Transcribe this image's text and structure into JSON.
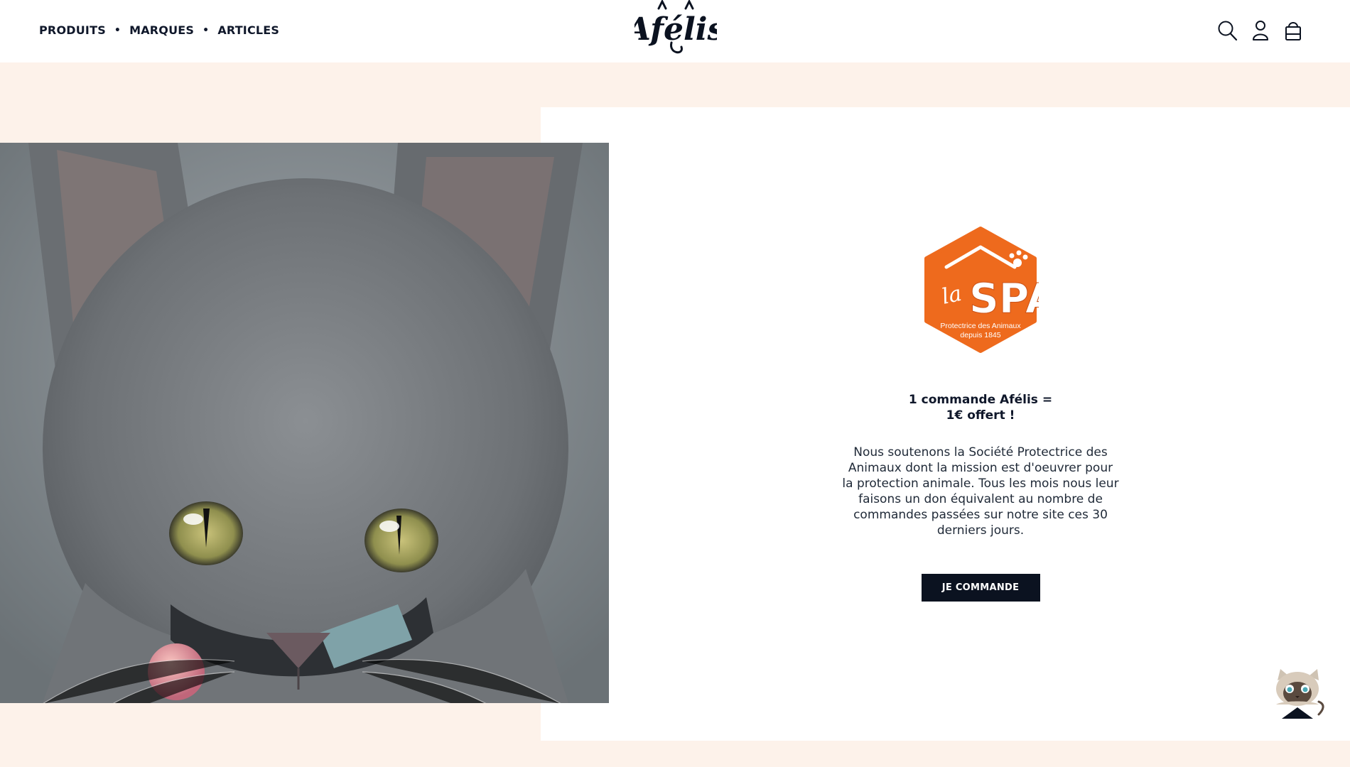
{
  "header": {
    "nav": [
      {
        "label": "PRODUITS"
      },
      {
        "label": "MARQUES"
      },
      {
        "label": "ARTICLES"
      }
    ],
    "nav_separator": "•",
    "logo_text": "Afélis",
    "icons": [
      "search-icon",
      "account-icon",
      "cart-icon"
    ]
  },
  "promo": {
    "partner_logo": {
      "brand": "la SPA",
      "tagline_line1": "Protectrice des Animaux",
      "tagline_line2": "depuis 1845",
      "color": "#ee6a1d"
    },
    "title_line1": "1 commande Afélis =",
    "title_line2": "1€ offert !",
    "body": "Nous soutenons la Société Protectrice des Animaux dont la mission est d'oeuvrer pour la protection animale. Tous les mois nous leur faisons un don équivalent au nombre de commandes passées sur notre site ces 30 derniers jours.",
    "cta_label": "JE COMMANDE"
  },
  "colors": {
    "background": "#fdf2ea",
    "panel": "#ffffff",
    "dark": "#0b1220",
    "accent": "#ee6a1d"
  }
}
